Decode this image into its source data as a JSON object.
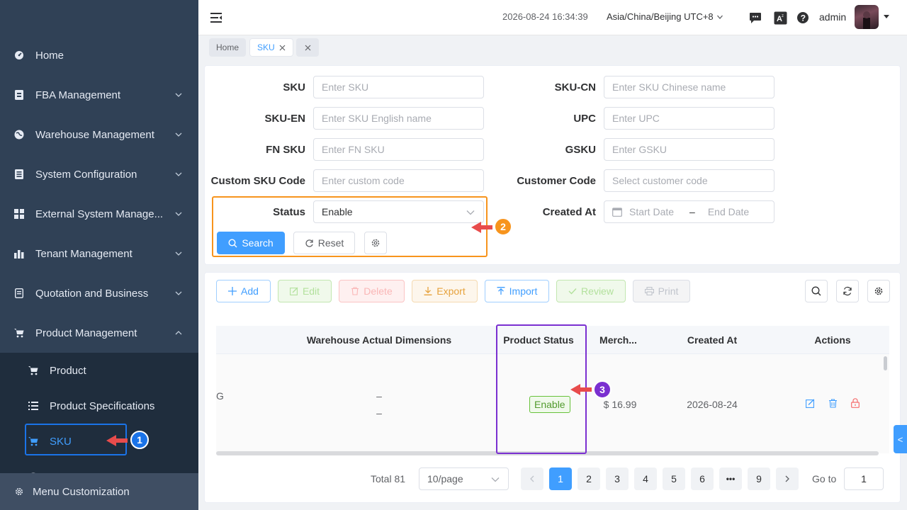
{
  "sidebar": {
    "items": [
      {
        "label": "Home",
        "icon": "dashboard-icon"
      },
      {
        "label": "FBA Management",
        "icon": "fba-icon"
      },
      {
        "label": "Warehouse Management",
        "icon": "globe-icon"
      },
      {
        "label": "System Configuration",
        "icon": "config-icon"
      },
      {
        "label": "External System Manage...",
        "icon": "grid-icon"
      },
      {
        "label": "Tenant Management",
        "icon": "bar-chart-icon"
      },
      {
        "label": "Quotation and Business",
        "icon": "quote-icon"
      },
      {
        "label": "Product Management",
        "icon": "cart-icon"
      }
    ],
    "sub_items": [
      {
        "label": "Product",
        "icon": "cart-icon"
      },
      {
        "label": "Product Specifications",
        "icon": "list-icon"
      },
      {
        "label": "SKU",
        "icon": "cart-icon"
      }
    ],
    "menu_customization": "Menu Customization"
  },
  "header": {
    "datetime": "2026-08-24 16:34:39",
    "timezone": "Asia/China/Beijing UTC+8",
    "user": "admin"
  },
  "tags": {
    "home": "Home",
    "sku": "SKU"
  },
  "search": {
    "sku_label": "SKU",
    "sku_placeholder": "Enter SKU",
    "sku_cn_label": "SKU-CN",
    "sku_cn_placeholder": "Enter SKU Chinese name",
    "sku_en_label": "SKU-EN",
    "sku_en_placeholder": "Enter SKU English name",
    "upc_label": "UPC",
    "upc_placeholder": "Enter UPC",
    "fnsku_label": "FN SKU",
    "fnsku_placeholder": "Enter FN SKU",
    "gsku_label": "GSKU",
    "gsku_placeholder": "Enter GSKU",
    "custom_label": "Custom SKU Code",
    "custom_placeholder": "Enter custom code",
    "customer_label": "Customer Code",
    "customer_placeholder": "Select customer code",
    "status_label": "Status",
    "status_value": "Enable",
    "created_label": "Created At",
    "start_placeholder": "Start Date",
    "end_placeholder": "End Date",
    "date_sep": "–",
    "search_btn": "Search",
    "reset_btn": "Reset"
  },
  "toolbar": {
    "add": "Add",
    "edit": "Edit",
    "delete": "Delete",
    "export": "Export",
    "import": "Import",
    "review": "Review",
    "print": "Print"
  },
  "table": {
    "columns": [
      "Warehouse Actual Dimensions",
      "Product Status",
      "Merch...",
      "Created At",
      "Actions"
    ],
    "row": {
      "partial_left": "G",
      "dimensions_1": "–",
      "dimensions_2": "–",
      "status": "Enable",
      "price": "$ 16.99",
      "created": "2026-08-24"
    }
  },
  "pagination": {
    "total": "Total 81",
    "page_size": "10/page",
    "pages": [
      "1",
      "2",
      "3",
      "4",
      "5",
      "6",
      "•••",
      "9"
    ],
    "current": "1",
    "goto_label": "Go to",
    "goto_value": "1"
  },
  "annotations": {
    "badge1": "1",
    "badge2": "2",
    "badge3": "3"
  },
  "colors": {
    "primary": "#409eff",
    "sidebar": "#304156",
    "orange": "#f7941d",
    "purple": "#7a2fd0",
    "blue_badge": "#1a73e8"
  },
  "side_tab": "<"
}
